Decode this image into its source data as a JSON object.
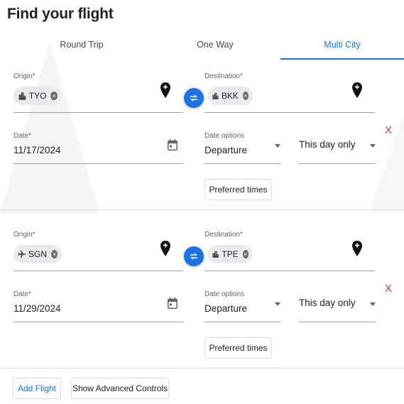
{
  "page": {
    "title": "Find your flight"
  },
  "tabs": [
    {
      "label": "Round Trip",
      "active": false
    },
    {
      "label": "One Way",
      "active": false
    },
    {
      "label": "Multi City",
      "active": true
    }
  ],
  "legs": [
    {
      "origin_label": "Origin*",
      "origin_value": "TYO",
      "origin_icon": "city-icon",
      "destination_label": "Destination*",
      "destination_value": "BKK",
      "destination_icon": "city-icon",
      "date_label": "Date*",
      "date_value": "11/17/2024",
      "date_options_label": "Date options",
      "date_option_value": "Departure",
      "flexibility_value": "This day only",
      "preferred_times_label": "Preferred times",
      "remove_label": "X"
    },
    {
      "origin_label": "Origin*",
      "origin_value": "SGN",
      "origin_icon": "airplane-icon",
      "destination_label": "Destination*",
      "destination_value": "TPE",
      "destination_icon": "city-icon",
      "date_label": "Date*",
      "date_value": "11/29/2024",
      "date_options_label": "Date options",
      "date_option_value": "Departure",
      "flexibility_value": "This day only",
      "preferred_times_label": "Preferred times",
      "remove_label": "X"
    }
  ],
  "footer": {
    "add_flight_label": "Add Flight",
    "advanced_controls_label": "Show Advanced Controls"
  },
  "colors": {
    "accent": "#1a73e8",
    "remove": "#e53935",
    "chip_bg": "#e8eaed"
  }
}
